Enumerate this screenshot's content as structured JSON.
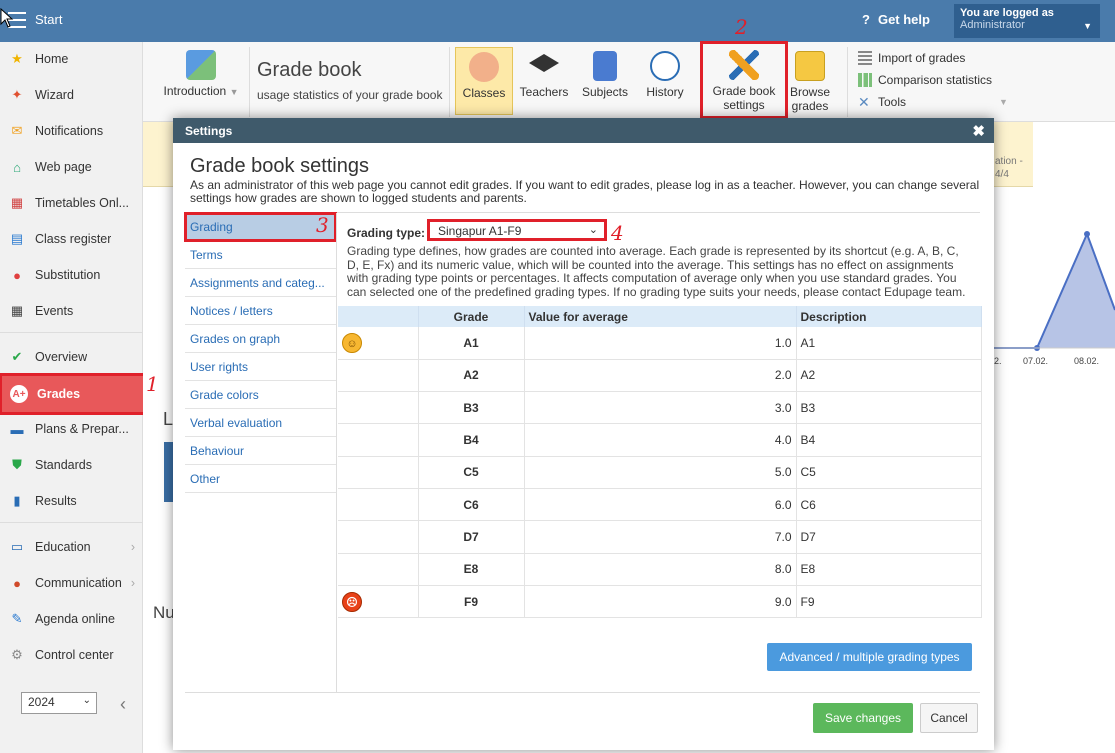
{
  "topbar": {
    "title": "Start",
    "help": "Get help",
    "logged_label": "You are logged as",
    "user": "Administrator"
  },
  "sidebar": {
    "items": [
      {
        "label": "Home",
        "icon": "star-icon"
      },
      {
        "label": "Wizard",
        "icon": "wand-icon"
      },
      {
        "label": "Notifications",
        "icon": "envelope-icon"
      },
      {
        "label": "Web page",
        "icon": "house-icon"
      },
      {
        "label": "Timetables Onl...",
        "icon": "timetable-icon"
      },
      {
        "label": "Class register",
        "icon": "register-icon"
      },
      {
        "label": "Substitution",
        "icon": "substitution-icon"
      },
      {
        "label": "Events",
        "icon": "calendar-icon"
      },
      {
        "label": "Overview",
        "icon": "check-circle-icon"
      },
      {
        "label": "Grades",
        "icon": "grades-icon"
      },
      {
        "label": "Plans & Prepar...",
        "icon": "plans-icon"
      },
      {
        "label": "Standards",
        "icon": "shield-check-icon"
      },
      {
        "label": "Results",
        "icon": "bar-chart-icon"
      },
      {
        "label": "Education",
        "icon": "book-icon"
      },
      {
        "label": "Communication",
        "icon": "chat-icon"
      },
      {
        "label": "Agenda online",
        "icon": "pen-icon"
      },
      {
        "label": "Control center",
        "icon": "gear-icon"
      }
    ],
    "year": "2024"
  },
  "toolbar": {
    "introduction": "Introduction",
    "title": "Grade book",
    "subtitle": "usage statistics of your grade book",
    "classes": "Classes",
    "teachers": "Teachers",
    "subjects": "Subjects",
    "history": "History",
    "gbs1": "Grade book",
    "gbs2": "settings",
    "browse1": "Browse",
    "browse2": "grades",
    "import": "Import of grades",
    "comparison": "Comparison statistics",
    "tools": "Tools"
  },
  "background": {
    "yellow1": "ation -",
    "yellow2": "4/4",
    "dates": [
      "2.",
      "07.02.",
      "08.02."
    ],
    "heading_l": "L",
    "heading_nu": "Nu"
  },
  "modal": {
    "header": "Settings",
    "title": "Grade book settings",
    "description": "As an administrator of this web page you cannot edit grades. If you want to edit grades, please log in as a teacher. However, you can change several settings how grades are shown to logged students and parents.",
    "menu": [
      "Grading",
      "Terms",
      "Assignments and categ...",
      "Notices / letters",
      "Grades on graph",
      "User rights",
      "Grade colors",
      "Verbal evaluation",
      "Behaviour",
      "Other"
    ],
    "grading_type_label": "Grading type:",
    "grading_type_value": "Singapur A1-F9",
    "grading_desc": "Grading type defines, how grades are counted into average. Each grade is represented by its shortcut (e.g. A, B, C, D, E, Fx) and its numeric value, which will be counted into the average. This settings has no effect on assignments with grading type points or percentages. It affects computation of average only when you use standard grades. You can selected one of the predefined grading types. If no grading type suits your needs, please contact Edupage team.",
    "columns": [
      "",
      "Grade",
      "Value for average",
      "Description"
    ],
    "rows": [
      {
        "face": "happy",
        "grade": "A1",
        "value": "1.0",
        "desc": "A1"
      },
      {
        "face": "",
        "grade": "A2",
        "value": "2.0",
        "desc": "A2"
      },
      {
        "face": "",
        "grade": "B3",
        "value": "3.0",
        "desc": "B3"
      },
      {
        "face": "",
        "grade": "B4",
        "value": "4.0",
        "desc": "B4"
      },
      {
        "face": "",
        "grade": "C5",
        "value": "5.0",
        "desc": "C5"
      },
      {
        "face": "",
        "grade": "C6",
        "value": "6.0",
        "desc": "C6"
      },
      {
        "face": "",
        "grade": "D7",
        "value": "7.0",
        "desc": "D7"
      },
      {
        "face": "",
        "grade": "E8",
        "value": "8.0",
        "desc": "E8"
      },
      {
        "face": "angry",
        "grade": "F9",
        "value": "9.0",
        "desc": "F9"
      }
    ],
    "advanced": "Advanced / multiple grading types",
    "save": "Save changes",
    "cancel": "Cancel"
  },
  "annotations": [
    "1",
    "2",
    "3",
    "4"
  ],
  "colors": {
    "topbar": "#4a7bab",
    "highlight": "#e0202a",
    "link": "#2a6db5",
    "save": "#5cb85c",
    "advanced": "#4b9ade"
  }
}
